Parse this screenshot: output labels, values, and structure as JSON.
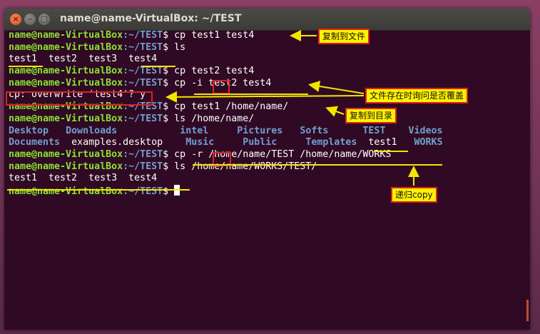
{
  "window": {
    "title": "name@name-VirtualBox: ~/TEST",
    "close_glyph": "×",
    "minimize_glyph": "–",
    "maximize_glyph": "□"
  },
  "terminal": {
    "prompt": "name@name-VirtualBox",
    "cwd": ":~/TEST",
    "dollar": "$ ",
    "lines": [
      {
        "cmd": "cp test1 test4"
      },
      {
        "cmd": "ls"
      },
      {
        "out": "test1  test2  test3  test4"
      },
      {
        "cmd": "cp test2 test4"
      },
      {
        "cmd": "cp -i test2 test4"
      },
      {
        "out": "cp: overwrite 'test4'? y"
      },
      {
        "cmd": "cp test1 /home/name/"
      },
      {
        "cmd": "ls /home/name/"
      },
      {
        "out_cols": [
          "Desktop",
          "Downloads",
          "intel",
          "Pictures",
          "Softs",
          "TEST",
          "Videos"
        ]
      },
      {
        "out_cols": [
          "Documents",
          "examples.desktop",
          "Music",
          "Public",
          "Templates",
          "test1",
          "WORKS"
        ]
      },
      {
        "cmd": "cp -r /home/name/TEST /home/name/WORKS"
      },
      {
        "cmd": "ls /home/name/WORKS/TEST/"
      },
      {
        "out": "test1  test2  test3  test4"
      },
      {
        "cmd": ""
      }
    ]
  },
  "annotations": {
    "copy_to_file": "复制到文件",
    "ask_overwrite": "文件存在时询问是否覆盖",
    "copy_to_dir": "复制到目录",
    "recursive_copy": "递归copy"
  },
  "colors": {
    "terminal_bg": "#300a24",
    "prompt_green": "#8ae234",
    "dir_blue": "#729fcf",
    "highlight_yellow": "#f2e600",
    "mark_red": "#e02020"
  }
}
